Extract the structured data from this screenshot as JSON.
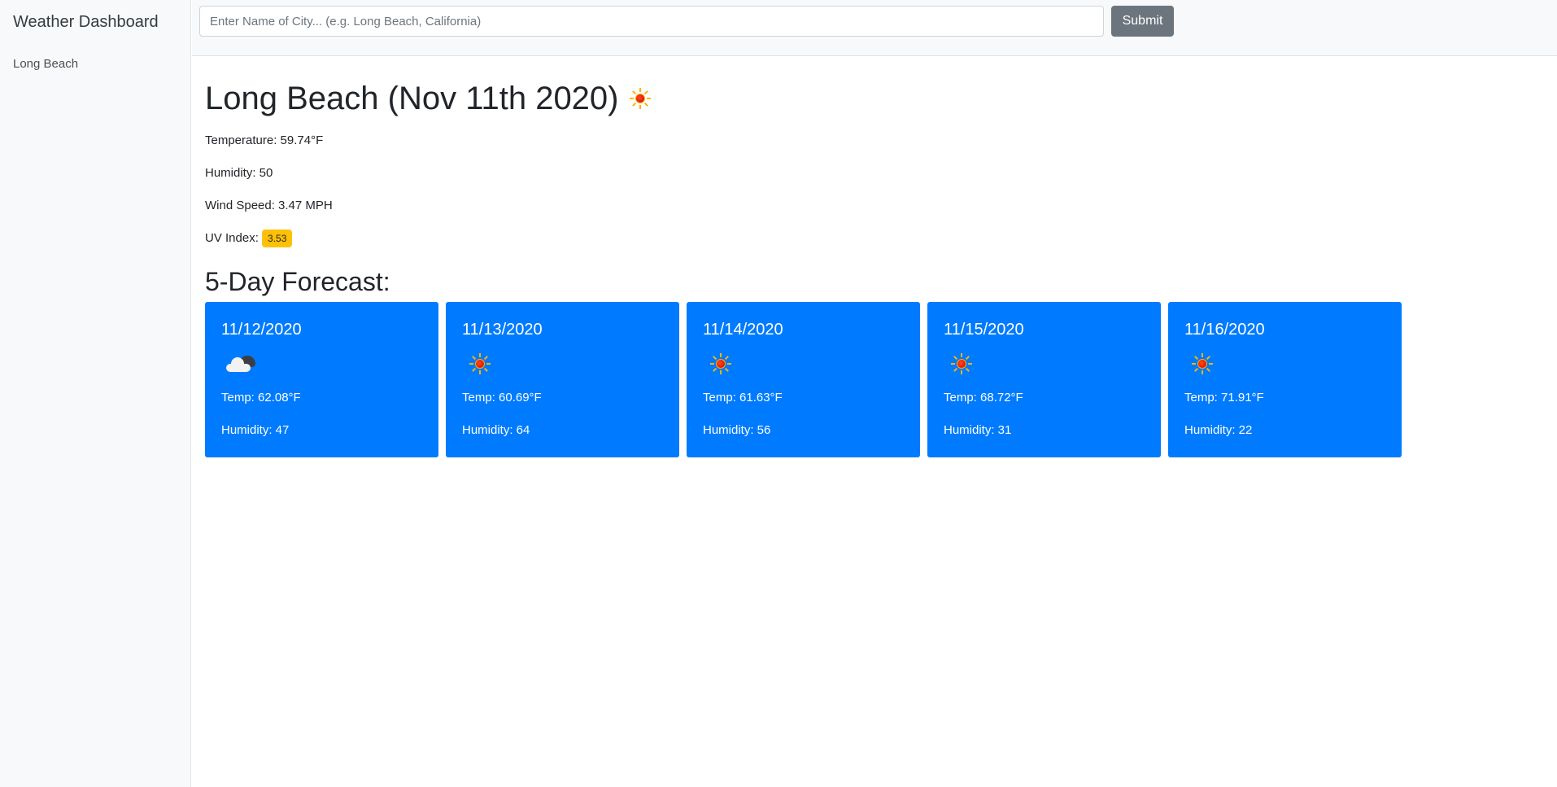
{
  "app": {
    "title": "Weather Dashboard"
  },
  "sidebar": {
    "history": [
      {
        "label": "Long Beach"
      }
    ]
  },
  "search": {
    "placeholder": "Enter Name of City... (e.g. Long Beach, California)",
    "value": "",
    "submit_label": "Submit"
  },
  "current": {
    "heading": "Long Beach (Nov 11th 2020)",
    "icon": "sun-icon",
    "temperature": "Temperature: 59.74°F",
    "humidity": "Humidity: 50",
    "wind": "Wind Speed: 3.47 MPH",
    "uv_label": "UV Index:",
    "uv_value": "3.53",
    "uv_color": "#ffc107"
  },
  "forecast": {
    "heading": "5-Day Forecast:",
    "card_color": "#007bff",
    "days": [
      {
        "date": "11/12/2020",
        "icon": "cloud-icon",
        "temp": "Temp: 62.08°F",
        "humidity": "Humidity: 47"
      },
      {
        "date": "11/13/2020",
        "icon": "sun-icon",
        "temp": "Temp: 60.69°F",
        "humidity": "Humidity: 64"
      },
      {
        "date": "11/14/2020",
        "icon": "sun-icon",
        "temp": "Temp: 61.63°F",
        "humidity": "Humidity: 56"
      },
      {
        "date": "11/15/2020",
        "icon": "sun-icon",
        "temp": "Temp: 68.72°F",
        "humidity": "Humidity: 31"
      },
      {
        "date": "11/16/2020",
        "icon": "sun-icon",
        "temp": "Temp: 71.91°F",
        "humidity": "Humidity: 22"
      }
    ]
  }
}
